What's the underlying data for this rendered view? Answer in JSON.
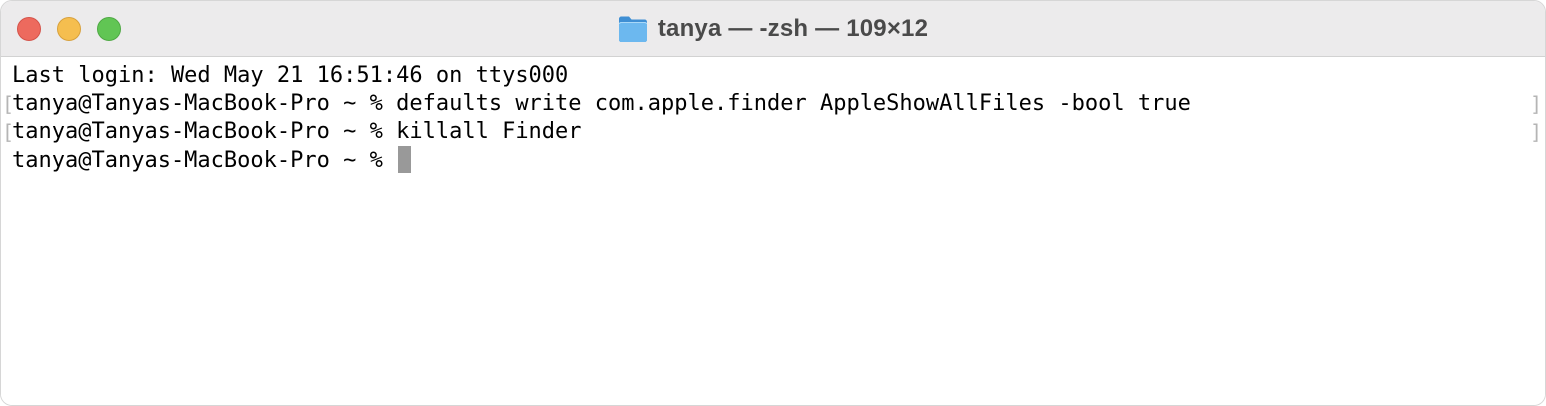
{
  "window": {
    "title": "tanya — -zsh — 109×12",
    "title_icon": "folder-icon"
  },
  "terminal": {
    "lines": [
      "Last login: Wed May 21 16:51:46 on ttys000",
      "tanya@Tanyas-MacBook-Pro ~ % defaults write com.apple.finder AppleShowAllFiles -bool true",
      "tanya@Tanyas-MacBook-Pro ~ % killall Finder",
      "tanya@Tanyas-MacBook-Pro ~ % "
    ],
    "left_mark": "[",
    "right_mark": "]"
  },
  "colors": {
    "titlebar": "#ecebec",
    "close": "#ed6a5e",
    "minimize": "#f5be4f",
    "zoom": "#61c554",
    "folder": "#5aa9e6",
    "cursor": "#999999"
  }
}
